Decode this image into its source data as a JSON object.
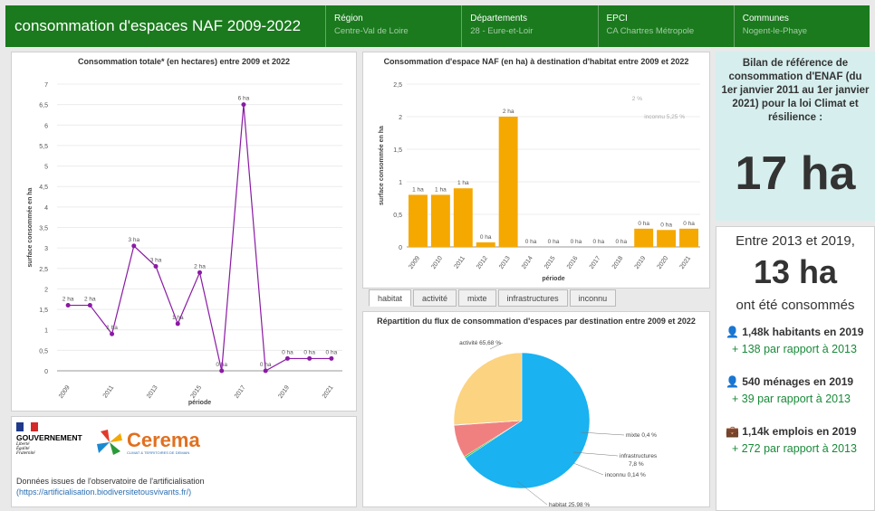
{
  "header": {
    "title": "consommation d'espaces NAF 2009-2022",
    "filters": [
      {
        "label": "Région",
        "value": "Centre-Val de Loire"
      },
      {
        "label": "Départements",
        "value": "28 - Eure-et-Loir"
      },
      {
        "label": "EPCI",
        "value": "CA Chartres Métropole"
      },
      {
        "label": "Communes",
        "value": "Nogent-le-Phaye"
      }
    ]
  },
  "chart_data": [
    {
      "type": "line",
      "title": "Consommation totale* (en hectares) entre 2009 et 2022",
      "xlabel": "période",
      "ylabel": "surface consommée en ha",
      "x": [
        2009,
        2010,
        2011,
        2012,
        2013,
        2014,
        2015,
        2016,
        2017,
        2018,
        2019,
        2020,
        2021
      ],
      "values": [
        1.6,
        1.6,
        0.9,
        3.05,
        2.55,
        1.15,
        2.4,
        0,
        6.5,
        0,
        0.3,
        0.3,
        0.3
      ],
      "labels": [
        "2 ha",
        "2 ha",
        "1 ha",
        "3 ha",
        "3 ha",
        "1 ha",
        "2 ha",
        "0 ha",
        "6 ha",
        "0 ha",
        "0 ha",
        "0 ha",
        "0 ha"
      ],
      "xticks": [
        "2009",
        "2011",
        "2013",
        "2015",
        "2017",
        "2019",
        "2021"
      ],
      "yticks": [
        "0",
        "0,5",
        "1",
        "1,5",
        "2",
        "2,5",
        "3",
        "3,5",
        "4",
        "4,5",
        "5",
        "5,5",
        "6",
        "6,5",
        "7"
      ],
      "ylim": [
        0,
        7
      ],
      "color": "#8a1aa5"
    },
    {
      "type": "bar",
      "title": "Consommation d'espace NAF (en ha) à destination d'habitat entre 2009 et 2022",
      "xlabel": "période",
      "ylabel": "surface consommée en ha",
      "categories": [
        "2009",
        "2010",
        "2011",
        "2012",
        "2013",
        "2014",
        "2015",
        "2016",
        "2017",
        "2018",
        "2019",
        "2020",
        "2021"
      ],
      "values": [
        0.8,
        0.8,
        0.9,
        0.07,
        2.0,
        0,
        0,
        0,
        0,
        0,
        0.28,
        0.26,
        0.28
      ],
      "labels": [
        "1 ha",
        "1 ha",
        "1 ha",
        "0 ha",
        "2 ha",
        "0 ha",
        "0 ha",
        "0 ha",
        "0 ha",
        "0 ha",
        "0 ha",
        "0 ha",
        "0 ha"
      ],
      "yticks": [
        "0",
        "0,5",
        "1",
        "1,5",
        "2",
        "2,5"
      ],
      "ylim": [
        0,
        2.5
      ],
      "color": "#f5a800",
      "annotations": [
        "2 %",
        "inconnu 5,25 %"
      ]
    },
    {
      "type": "pie",
      "title": "Répartition du flux de consommation d'espaces par destination entre 2009 et 2022",
      "slices": [
        {
          "name": "activité",
          "value": 65.68,
          "label": "activité 65,68 %",
          "color": "#1ab2f0"
        },
        {
          "name": "mixte",
          "value": 0.4,
          "label": "mixte 0,4 %",
          "color": "#3ec24a"
        },
        {
          "name": "infrastructures",
          "value": 7.8,
          "label": "infrastructures 7,8 %",
          "color": "#f08080"
        },
        {
          "name": "inconnu",
          "value": 0.14,
          "label": "inconnu 0,14 %",
          "color": "#9a9a9a"
        },
        {
          "name": "habitat",
          "value": 25.98,
          "label": "habitat 25,98 %",
          "color": "#fcd380"
        }
      ]
    }
  ],
  "tabs": [
    "habitat",
    "activité",
    "mixte",
    "infrastructures",
    "inconnu"
  ],
  "kpi": {
    "title": "Bilan de référence de consommation d'ENAF (du 1er janvier 2011 au 1er janvier 2021) pour la loi Climat et résilience :",
    "value": "17 ha",
    "period": "Entre 2013 et 2019,",
    "period_value": "13 ha",
    "period_suffix": "ont été consommés",
    "stats": [
      {
        "text": "1,48k habitants en 2019",
        "delta": "+ 138 par rapport à 2013"
      },
      {
        "text": "540 ménages en 2019",
        "delta": "+ 39 par rapport à 2013"
      },
      {
        "text": "1,14k emplois en 2019",
        "delta": "+ 272 par rapport à 2013"
      }
    ]
  },
  "logos": {
    "gov_title": "GOUVERNEMENT",
    "gov_motto": [
      "Liberté",
      "Égalité",
      "Fraternité"
    ],
    "cerema": "Cerema",
    "cerema_sub": "CLIMAT & TERRITOIRES DE DEMAIN"
  },
  "source": {
    "text": "Données issues de l'observatoire de l'artificialisation",
    "link": "(https://artificialisation.biodiversitetousvivants.fr/)"
  }
}
